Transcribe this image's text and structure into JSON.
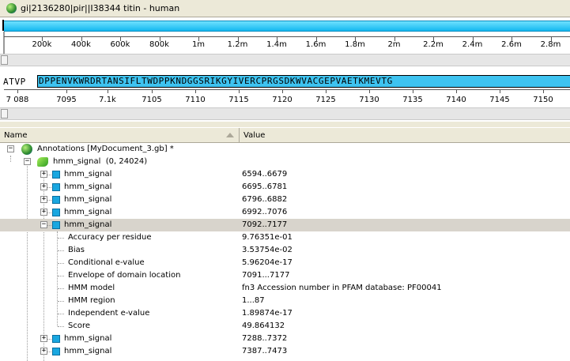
{
  "window": {
    "title": "gi|2136280|pir||I38344 titin - human"
  },
  "overview": {
    "ticks": [
      "200k",
      "400k",
      "600k",
      "800k",
      "1m",
      "1.2m",
      "1.4m",
      "1.6m",
      "1.8m",
      "2m",
      "2.2m",
      "2.4m",
      "2.6m",
      "2.8m"
    ]
  },
  "sequence": {
    "plain": "ATVP",
    "highlight": "DPPENVKWRDRTANSIFLTWDPPKNDGGSRIKGYIVERCPRGSDKWVACGEPVAETKMEVTG",
    "ticks": [
      "7 088",
      "7095",
      "7.1k",
      "7105",
      "7110",
      "7115",
      "7120",
      "7125",
      "7130",
      "7135",
      "7140",
      "7145",
      "7150"
    ]
  },
  "table": {
    "columns": {
      "name": "Name",
      "value": "Value"
    },
    "root": {
      "label": "Annotations [MyDocument_3.gb] *"
    },
    "group": {
      "label": "hmm_signal",
      "range": "(0, 24024)"
    },
    "rows": [
      {
        "name": "hmm_signal",
        "value": "6594..6679"
      },
      {
        "name": "hmm_signal",
        "value": "6695..6781"
      },
      {
        "name": "hmm_signal",
        "value": "6796..6882"
      },
      {
        "name": "hmm_signal",
        "value": "6992..7076"
      },
      {
        "name": "hmm_signal",
        "value": "7092..7177"
      }
    ],
    "qualifiers": [
      {
        "name": "Accuracy per residue",
        "value": "9.76351e-01"
      },
      {
        "name": "Bias",
        "value": "3.53754e-02"
      },
      {
        "name": "Conditional e-value",
        "value": "5.96204e-17"
      },
      {
        "name": "Envelope of domain location",
        "value": "7091...7177"
      },
      {
        "name": "HMM model",
        "value": "fn3  Accession number in PFAM database: PF00041"
      },
      {
        "name": "HMM region",
        "value": "1...87"
      },
      {
        "name": "Independent e-value",
        "value": "1.89874e-17"
      },
      {
        "name": "Score",
        "value": "49.864132"
      }
    ],
    "more_rows": [
      {
        "name": "hmm_signal",
        "value": "7288..7372"
      },
      {
        "name": "hmm_signal",
        "value": "7387..7473"
      }
    ]
  },
  "colors": {
    "accent": "#19a7e0",
    "selection": "#d8d4cc",
    "chrome": "#ece9d8"
  }
}
